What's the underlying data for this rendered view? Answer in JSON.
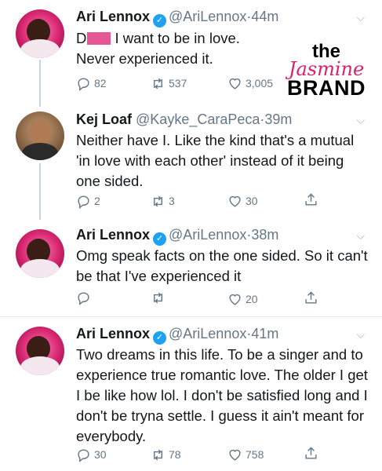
{
  "tweets": [
    {
      "name": "Ari Lennox",
      "verified": true,
      "handle": "@AriLennox",
      "dot": "·",
      "time": "44m",
      "text_after_redaction": " I want to be in love. Never experienced it.",
      "replies": "82",
      "retweets": "537",
      "likes": "3,005"
    },
    {
      "name": "Kej Loaf",
      "verified": false,
      "handle": "@Kayke_CaraPeca",
      "dot": "·",
      "time": "39m",
      "text": "Neither have I. Like the kind that's a mutual 'in love with each other' instead of it being one sided.",
      "replies": "2",
      "retweets": "3",
      "likes": "30"
    },
    {
      "name": "Ari Lennox",
      "verified": true,
      "handle": "@AriLennox",
      "dot": "·",
      "time": "38m",
      "text": "Omg speak facts on the one sided. So it can't be that I've experienced it",
      "replies": "",
      "retweets": "",
      "likes": "20"
    },
    {
      "name": "Ari Lennox",
      "verified": true,
      "handle": "@AriLennox",
      "dot": "·",
      "time": "41m",
      "text": "Two dreams in this life. To be a singer and to experience true romantic love. The older I get I be like how lol. I don't be satisfied long and I don't be tryna settle. I guess it ain't meant for everybody.",
      "replies": "30",
      "retweets": "78",
      "likes": "758"
    }
  ],
  "watermark": {
    "line1": "the",
    "line2": "Jasmine",
    "line3": "BRAND"
  },
  "icons": {
    "reply": "reply-icon",
    "retweet": "retweet-icon",
    "like": "heart-icon",
    "share": "share-icon",
    "verified": "verified-badge-icon",
    "more": "chevron-down-icon"
  },
  "colors": {
    "verified_blue": "#1da1f2",
    "muted_text": "#657786",
    "watermark_pink": "#e01f6b"
  }
}
